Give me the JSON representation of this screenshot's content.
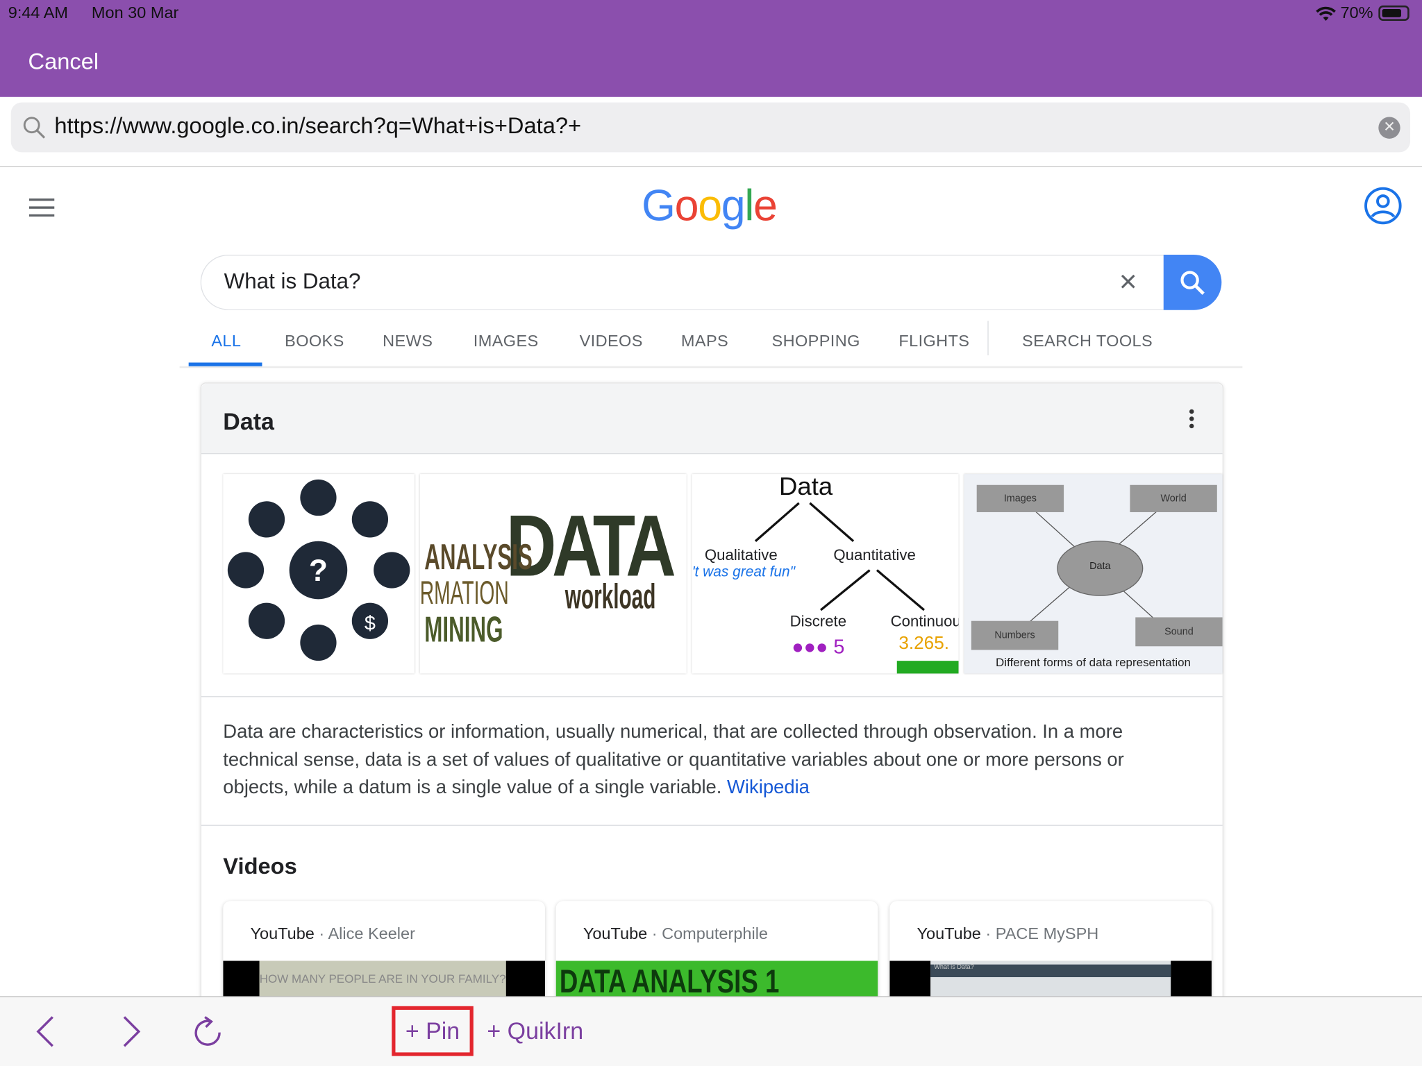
{
  "status_bar": {
    "time": "9:44 AM",
    "date": "Mon 30 Mar",
    "battery": "70%",
    "battery_level": 0.7
  },
  "header": {
    "cancel_label": "Cancel"
  },
  "url_bar": {
    "value": "https://www.google.co.in/search?q=What+is+Data?+"
  },
  "google": {
    "logo": "Google",
    "search_value": "What is Data?",
    "tabs": [
      {
        "label": "ALL",
        "active": true
      },
      {
        "label": "BOOKS"
      },
      {
        "label": "NEWS"
      },
      {
        "label": "IMAGES"
      },
      {
        "label": "VIDEOS"
      },
      {
        "label": "MAPS"
      },
      {
        "label": "SHOPPING"
      },
      {
        "label": "FLIGHTS"
      },
      {
        "label": "SEARCH TOOLS"
      }
    ]
  },
  "knowledge_panel": {
    "title": "Data",
    "images": [
      {
        "text": "?"
      },
      {
        "text": "DATA"
      },
      {
        "title": "Data",
        "left": "Qualitative",
        "right": "Quantitative",
        "quote": "'t was great fun\"",
        "discrete": "Discrete",
        "continuous": "Continuou",
        "num1": "5",
        "num2": "3.265."
      },
      {
        "nodes": [
          "Images",
          "World",
          "Data",
          "Numbers",
          "Sound"
        ],
        "caption": "Different forms of data representation"
      }
    ],
    "description": "Data are characteristics or information, usually numerical, that are collected through observation. In a more technical sense, data is a set of values of qualitative or quantitative variables about one or more persons or objects, while a datum is a single value of a single variable. ",
    "source_link": "Wikipedia",
    "videos_heading": "Videos",
    "videos": [
      {
        "source": "YouTube",
        "channel": " · Alice Keeler",
        "thumb_text": "HOW MANY PEOPLE ARE IN YOUR FAMILY?"
      },
      {
        "source": "YouTube",
        "channel": " · Computerphile",
        "thumb_text": "DATA ANALYSIS 1"
      },
      {
        "source": "YouTube",
        "channel": " · PACE MySPH",
        "thumb_text": "What is Data?"
      }
    ]
  },
  "bottom_bar": {
    "pin_label": "+ Pin",
    "quiklrn_label": "+ QuikIrn"
  },
  "colors": {
    "header_purple": "#8b4fad",
    "google_blue": "#4285f4",
    "accent_purple": "#7b3fa0",
    "highlight_red": "#e3262e"
  }
}
